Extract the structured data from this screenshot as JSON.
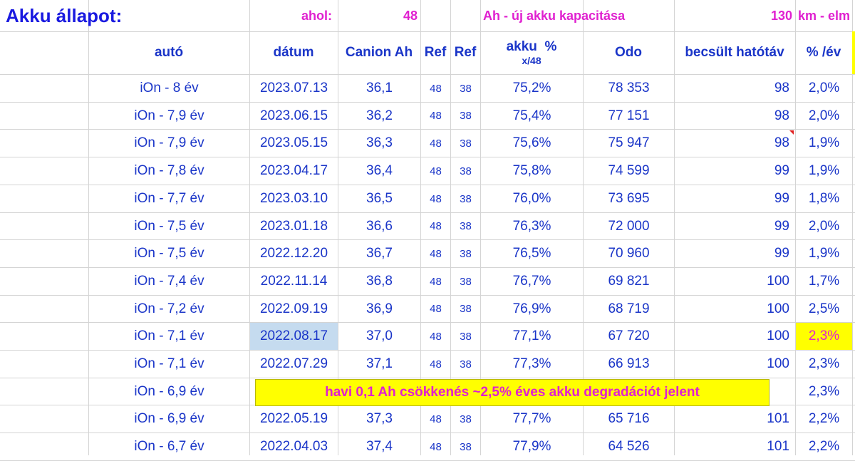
{
  "sheet": {
    "title": "Akku állapot:",
    "top_row": {
      "ahol_label": "ahol:",
      "capacity_value": "48",
      "capacity_note": "Ah - új akku kapacitása",
      "range_value": "130",
      "range_note": "km - elm"
    },
    "headers": {
      "auto": "autó",
      "datum": "dátum",
      "canion": "Canion Ah",
      "ref1": "Ref",
      "ref2": "Ref",
      "akku": "akku  %",
      "akku_sub": "x/48",
      "odo": "Odo",
      "hatotav": "becsült hatótáv",
      "pct_ev": "% /év"
    },
    "rows": [
      {
        "auto": "iOn - 8 év",
        "datum": "2023.07.13",
        "canion": "36,1",
        "ref1": "48",
        "ref2": "38",
        "akku": "75,2%",
        "odo": "78 353",
        "hatotav": "98",
        "pct": "2,0%"
      },
      {
        "auto": "iOn - 7,9 év",
        "datum": "2023.06.15",
        "canion": "36,2",
        "ref1": "48",
        "ref2": "38",
        "akku": "75,4%",
        "odo": "77 151",
        "hatotav": "98",
        "pct": "2,0%"
      },
      {
        "auto": "iOn - 7,9 év",
        "datum": "2023.05.15",
        "canion": "36,3",
        "ref1": "48",
        "ref2": "38",
        "akku": "75,6%",
        "odo": "75 947",
        "hatotav": "98",
        "pct": "1,9%"
      },
      {
        "auto": "iOn - 7,8 év",
        "datum": "2023.04.17",
        "canion": "36,4",
        "ref1": "48",
        "ref2": "38",
        "akku": "75,8%",
        "odo": "74 599",
        "hatotav": "99",
        "pct": "1,9%"
      },
      {
        "auto": "iOn - 7,7 év",
        "datum": "2023.03.10",
        "canion": "36,5",
        "ref1": "48",
        "ref2": "38",
        "akku": "76,0%",
        "odo": "73 695",
        "hatotav": "99",
        "pct": "1,8%"
      },
      {
        "auto": "iOn - 7,5 év",
        "datum": "2023.01.18",
        "canion": "36,6",
        "ref1": "48",
        "ref2": "38",
        "akku": "76,3%",
        "odo": "72 000",
        "hatotav": "99",
        "pct": "2,0%"
      },
      {
        "auto": "iOn - 7,5 év",
        "datum": "2022.12.20",
        "canion": "36,7",
        "ref1": "48",
        "ref2": "38",
        "akku": "76,5%",
        "odo": "70 960",
        "hatotav": "99",
        "pct": "1,9%"
      },
      {
        "auto": "iOn - 7,4 év",
        "datum": "2022.11.14",
        "canion": "36,8",
        "ref1": "48",
        "ref2": "38",
        "akku": "76,7%",
        "odo": "69 821",
        "hatotav": "100",
        "pct": "1,7%"
      },
      {
        "auto": "iOn - 7,2 év",
        "datum": "2022.09.19",
        "canion": "36,9",
        "ref1": "48",
        "ref2": "38",
        "akku": "76,9%",
        "odo": "68 719",
        "hatotav": "100",
        "pct": "2,5%"
      },
      {
        "auto": "iOn - 7,1 év",
        "datum": "2022.08.17",
        "canion": "37,0",
        "ref1": "48",
        "ref2": "38",
        "akku": "77,1%",
        "odo": "67 720",
        "hatotav": "100",
        "pct": "2,3%"
      },
      {
        "auto": "iOn - 7,1 év",
        "datum": "2022.07.29",
        "canion": "37,1",
        "ref1": "48",
        "ref2": "38",
        "akku": "77,3%",
        "odo": "66 913",
        "hatotav": "100",
        "pct": "2,3%"
      },
      {
        "auto": "iOn - 6,9 év",
        "datum": "",
        "canion": "",
        "ref1": "",
        "ref2": "",
        "akku": "",
        "odo": "",
        "hatotav": "",
        "pct": "2,3%"
      },
      {
        "auto": "iOn - 6,9 év",
        "datum": "2022.05.19",
        "canion": "37,3",
        "ref1": "48",
        "ref2": "38",
        "akku": "77,7%",
        "odo": "65 716",
        "hatotav": "101",
        "pct": "2,2%"
      },
      {
        "auto": "iOn - 6,7 év",
        "datum": "2022.04.03",
        "canion": "37,4",
        "ref1": "48",
        "ref2": "38",
        "akku": "77,9%",
        "odo": "64 526",
        "hatotav": "101",
        "pct": "2,2%"
      }
    ],
    "note": "havi 0,1 Ah csökkenés ~2,5% éves akku degradációt jelent",
    "colors": {
      "text_blue": "#1a35c8",
      "magenta": "#e020d0",
      "highlight_yellow": "#ffff00",
      "selected_cell": "#c5dbef"
    }
  }
}
